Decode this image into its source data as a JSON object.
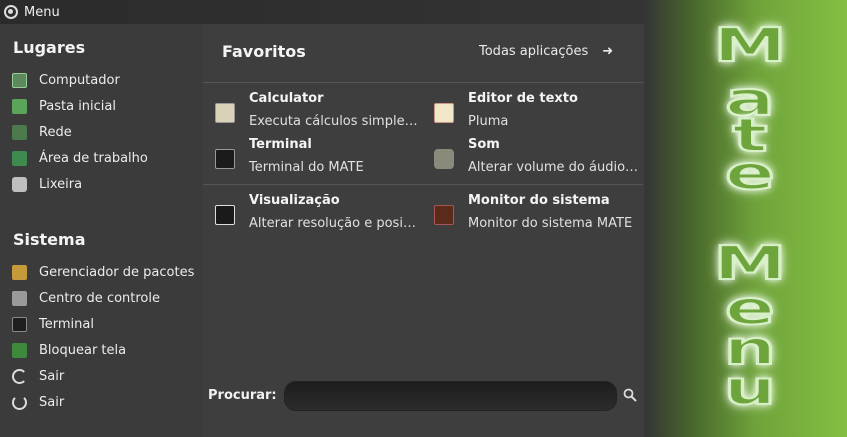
{
  "topbar": {
    "menu_label": "Menu"
  },
  "lugares": {
    "title": "Lugares",
    "items": [
      {
        "label": "Computador",
        "icon": "computer-icon"
      },
      {
        "label": "Pasta inicial",
        "icon": "home-folder-icon"
      },
      {
        "label": "Rede",
        "icon": "network-icon"
      },
      {
        "label": "Área de trabalho",
        "icon": "desktop-icon"
      },
      {
        "label": "Lixeira",
        "icon": "trash-icon"
      }
    ]
  },
  "sistema": {
    "title": "Sistema",
    "items": [
      {
        "label": "Gerenciador de pacotes",
        "icon": "package-manager-icon"
      },
      {
        "label": "Centro de controle",
        "icon": "control-center-icon"
      },
      {
        "label": "Terminal",
        "icon": "terminal-icon"
      },
      {
        "label": "Bloquear tela",
        "icon": "lock-screen-icon"
      },
      {
        "label": "Sair",
        "icon": "logout-icon"
      },
      {
        "label": "Sair",
        "icon": "power-icon"
      }
    ]
  },
  "favoritos": {
    "title": "Favoritos",
    "all_apps": "Todas aplicações",
    "apps": [
      {
        "name": "Calculator",
        "desc": "Executa cálculos simple…",
        "icon": "calculator-icon"
      },
      {
        "name": "Editor de texto",
        "desc": "Pluma",
        "icon": "text-editor-icon"
      },
      {
        "name": "Terminal",
        "desc": "Terminal do MATE",
        "icon": "terminal-icon"
      },
      {
        "name": "Som",
        "desc": "Alterar volume do áudio…",
        "icon": "sound-icon"
      },
      {
        "name": "Visualização",
        "desc": "Alterar resolução e posi…",
        "icon": "display-icon"
      },
      {
        "name": "Monitor do sistema",
        "desc": "Monitor do sistema MATE",
        "icon": "system-monitor-icon"
      }
    ]
  },
  "search": {
    "label": "Procurar:",
    "value": ""
  },
  "wallpaper": {
    "letters": [
      "M",
      "a",
      "t",
      "e",
      "M",
      "e",
      "n",
      "u"
    ]
  },
  "colors": {
    "accent_green": "#84bf42",
    "panel": "#3b3b3b"
  }
}
